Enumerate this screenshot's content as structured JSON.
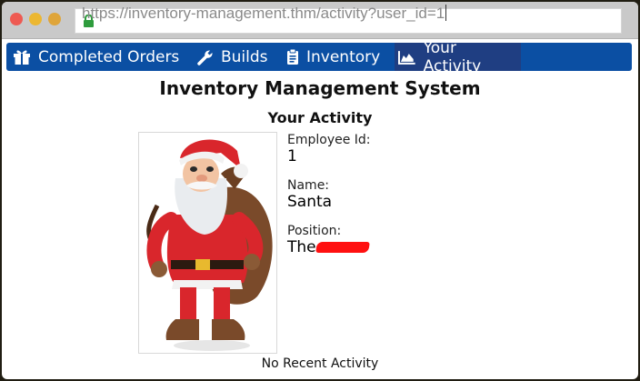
{
  "browser": {
    "url": "https://inventory-management.thm/activity?user_id=1"
  },
  "nav": {
    "items": [
      {
        "label": "Completed Orders",
        "icon": "gift-icon"
      },
      {
        "label": "Builds",
        "icon": "wrench-icon"
      },
      {
        "label": "Inventory",
        "icon": "clipboard-icon"
      },
      {
        "label": "Your Activity",
        "icon": "area-chart-icon",
        "active": true
      }
    ]
  },
  "page": {
    "title": "Inventory Management System",
    "section_title": "Your Activity"
  },
  "profile": {
    "photo_alt": "santa-photo",
    "employee_id_label": "Employee Id:",
    "employee_id": "1",
    "name_label": "Name:",
    "name": "Santa",
    "position_label": "Position:",
    "position_prefix": "The"
  },
  "activity": {
    "empty_text": "No Recent Activity"
  },
  "colors": {
    "navbar": "#0b4fa3",
    "navbar_active": "#1f3e82",
    "redaction": "#ff1010"
  }
}
